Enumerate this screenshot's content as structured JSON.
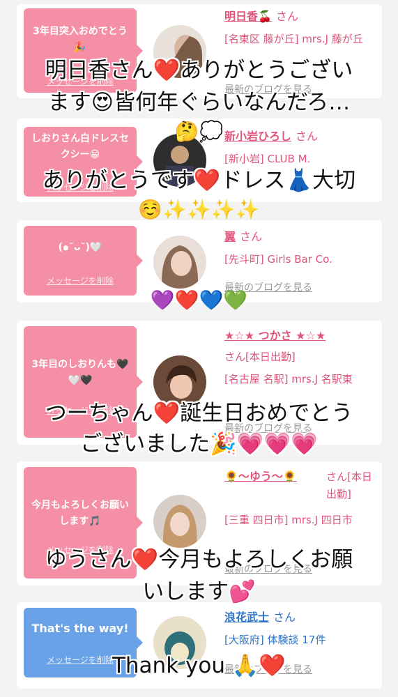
{
  "common": {
    "delete_label": "メッセージを削除",
    "blog_label": "最新のブログを見る",
    "san": "さん"
  },
  "cards": [
    {
      "message": "3年目突入おめでとう🎉",
      "name": "明日香🍒",
      "shop": "[名東区 藤が丘] mrs.J 藤が丘"
    },
    {
      "message": "しおりさん白ドレスセクシー😁",
      "name": "新小岩ひろし",
      "shop": "[新小岩] CLUB M."
    },
    {
      "message": "(๑˘ᴗ˘)🤍",
      "name": "翼",
      "shop": "[先斗町] Girls Bar Co."
    },
    {
      "message": "3年目のしおりんも🖤🤍🖤",
      "name": "★☆★ つかさ ★☆★",
      "san_extra": "さん[本日出勤]",
      "shop": "[名古屋 名駅] mrs.J 名駅東"
    },
    {
      "message": "今月もよろしくお願いします🎵",
      "name": "🌻〜ゆう〜🌻",
      "san_extra": "さん[本日出勤]",
      "shop": "[三重 四日市] mrs.J 四日市"
    },
    {
      "message": "That's the way!",
      "name": "浪花武士",
      "shop": "[大阪府] 体験談 17件"
    }
  ],
  "overlays": {
    "line1": "明日香さん❤️ありがとうござい",
    "line2": "ます😍皆何年ぐらいなんだろ…",
    "line3": "🤔💭",
    "line4": "ありがとうです❤️ドレス👗大切",
    "line5": "☺️✨✨✨✨",
    "line6": "💜❤️💙💚",
    "line7": "つーちゃん❤️誕生日おめでとう",
    "line8": "ございました🎉💗💗💗",
    "line9": "ゆうさん❤️今月もよろしくお願",
    "line10": "いします💕",
    "line11": "Thank you 🙏❤️"
  },
  "colors": {
    "pink": "#f58fa5",
    "blue": "#6aa2e8",
    "name_pink": "#e1547a",
    "name_blue": "#2f74c9"
  }
}
